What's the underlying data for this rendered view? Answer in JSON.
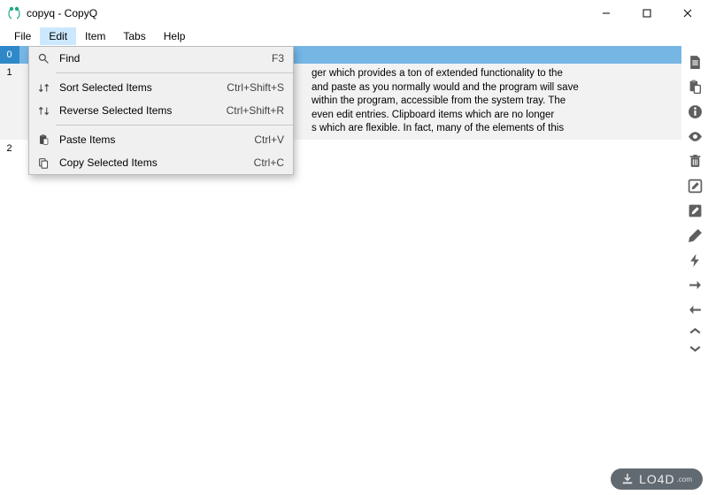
{
  "window": {
    "title": "copyq - CopyQ"
  },
  "menubar": {
    "items": [
      "File",
      "Edit",
      "Item",
      "Tabs",
      "Help"
    ],
    "active_index": 1
  },
  "edit_menu": {
    "items": [
      {
        "icon": "search",
        "label": "Find",
        "shortcut": "F3"
      },
      {
        "sep": true
      },
      {
        "icon": "sort-asc",
        "label": "Sort Selected Items",
        "shortcut": "Ctrl+Shift+S"
      },
      {
        "icon": "sort-desc",
        "label": "Reverse Selected Items",
        "shortcut": "Ctrl+Shift+R"
      },
      {
        "sep": true
      },
      {
        "icon": "paste",
        "label": "Paste Items",
        "shortcut": "Ctrl+V"
      },
      {
        "icon": "copy",
        "label": "Copy Selected Items",
        "shortcut": "Ctrl+C"
      }
    ]
  },
  "list": {
    "rows": [
      {
        "num": "0",
        "text": ""
      },
      {
        "num": "1",
        "text": "ger which provides a ton of extended functionality to the \nand paste as you normally would and the program will save \nwithin the program, accessible from the system tray. The \n even edit entries. Clipboard items which are no longer \ns which are flexible. In fact, many of the elements of this"
      },
      {
        "num": "2",
        "text": ""
      }
    ]
  },
  "toolbar": {
    "icons": [
      "file-icon",
      "paste-icon",
      "info-icon",
      "eye-icon",
      "trash-icon",
      "edit-box-icon",
      "edit-fill-icon",
      "pencil-icon",
      "bolt-icon",
      "arrow-right-icon",
      "arrow-left-icon",
      "chevron-up-icon",
      "chevron-down-icon"
    ]
  },
  "watermark": {
    "label": "LO4D",
    "suffix": ".com"
  }
}
